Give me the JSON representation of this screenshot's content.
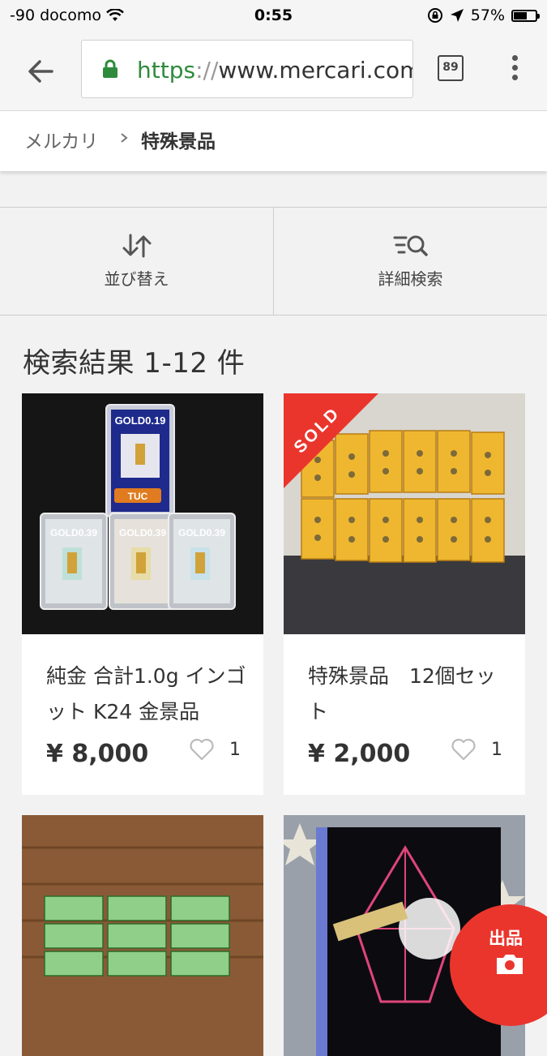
{
  "status_bar": {
    "carrier": "-90 docomo",
    "time": "0:55",
    "battery": "57%"
  },
  "browser": {
    "url_scheme": "https",
    "url_separator": "://",
    "url_host": "www.mercari.com/",
    "tab_count": "89"
  },
  "breadcrumb": {
    "home": "メルカリ",
    "current": "特殊景品"
  },
  "actions": {
    "sort_label": "並び替え",
    "filter_label": "詳細検索"
  },
  "results": {
    "heading": "検索結果 1-12 件"
  },
  "products": [
    {
      "name": "純金 合計1.0g インゴット K24 金景品",
      "price": "¥ 8,000",
      "likes": "1",
      "sold": false,
      "sold_label": ""
    },
    {
      "name": "特殊景品　12個セット",
      "price": "¥ 2,000",
      "likes": "1",
      "sold": true,
      "sold_label": "SOLD"
    }
  ],
  "thumb_texts": {
    "gold_top": "GOLD0.19",
    "gold_a": "GOLD0.39",
    "gold_b": "GOLD0.39",
    "gold_c": "GOLD0.39",
    "tuc": "TUC"
  },
  "sell_button": {
    "label": "出品"
  },
  "colors": {
    "accent_red": "#ea352d",
    "secure_green": "#2e8b3c"
  }
}
